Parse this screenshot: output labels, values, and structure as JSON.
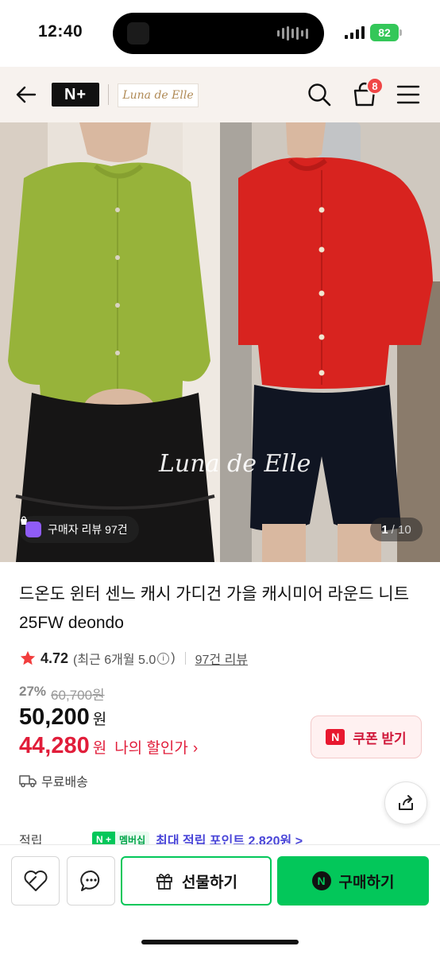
{
  "status_bar": {
    "time": "12:40",
    "battery": "82"
  },
  "header": {
    "logo_text": "N+",
    "brand_name": "Luna de Elle",
    "cart_count": "8",
    "icons": {
      "back": "back-arrow-icon",
      "search": "search-icon",
      "cart": "shopping-bag-icon",
      "menu": "hamburger-menu-icon"
    }
  },
  "gallery": {
    "watermark": "Luna de Elle",
    "review_chip": "구매자 리뷰 97건",
    "current_index": "1",
    "total": "/ 10"
  },
  "product": {
    "title": "드온도 윈터 센느 캐시 가디건 가을 캐시미어 라운드 니트 25FW deondo",
    "rating": "4.72",
    "rating_detail_prefix": "(최근 6개월 5.0",
    "rating_detail_suffix": ")",
    "review_link": "97건 리뷰",
    "discount_pct": "27%",
    "original_price": "60,700원",
    "price": "50,200",
    "my_price": "44,280",
    "won": "원",
    "my_price_label": "나의 할인가",
    "coupon_label": "쿠폰 받기",
    "shipping": "무료배송",
    "points_label": "적립",
    "membership_badge_n": "N +",
    "membership_badge_text": "멤버십",
    "points_text": "최대 적립 포인트 2,820원 >"
  },
  "bottom_bar": {
    "gift_label": "선물하기",
    "buy_label": "구매하기"
  },
  "colors": {
    "accent_green": "#03c75a",
    "sale_red": "#e11d3a",
    "header_bg": "#f7f2ee"
  }
}
